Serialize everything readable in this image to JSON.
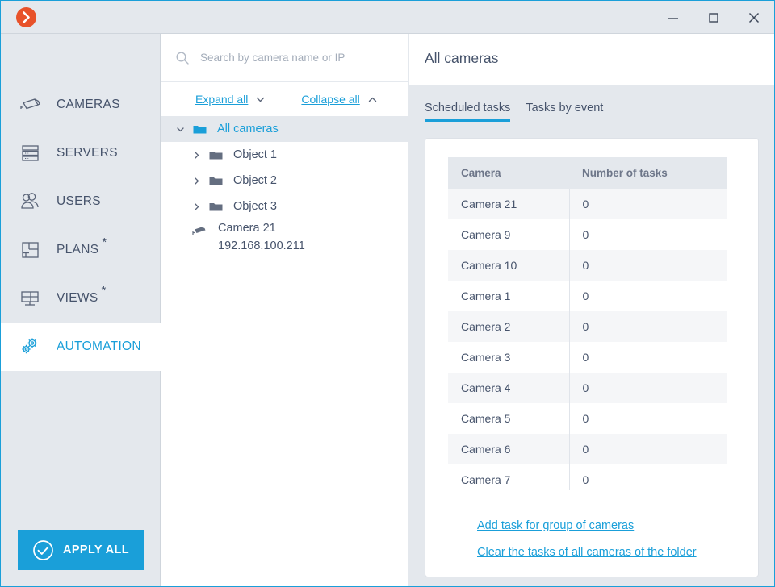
{
  "window": {
    "logo_icon": "chevron-right-circle-icon",
    "controls": [
      {
        "name": "minimize",
        "icon": "minimize-icon"
      },
      {
        "name": "maximize",
        "icon": "maximize-icon"
      },
      {
        "name": "close",
        "icon": "close-icon"
      }
    ]
  },
  "colors": {
    "accent": "#1a9fd9",
    "logo": "#e8522a",
    "text": "#46536b",
    "panel": "#e4e8ed"
  },
  "sidebar": {
    "items": [
      {
        "label": "CAMERAS",
        "icon": "camera-icon",
        "star": "",
        "active": false
      },
      {
        "label": "SERVERS",
        "icon": "server-icon",
        "star": "",
        "active": false
      },
      {
        "label": "USERS",
        "icon": "users-icon",
        "star": "",
        "active": false
      },
      {
        "label": "PLANS",
        "icon": "plans-icon",
        "star": "*",
        "active": false
      },
      {
        "label": "VIEWS",
        "icon": "views-icon",
        "star": "*",
        "active": false
      },
      {
        "label": "AUTOMATION",
        "icon": "gears-icon",
        "star": "",
        "active": true
      }
    ],
    "apply_all": {
      "label": "APPLY ALL",
      "icon": "check-circle-icon"
    }
  },
  "tree_panel": {
    "search": {
      "placeholder": "Search by camera name or IP",
      "value": "",
      "icon": "search-icon"
    },
    "expand_all": {
      "label": "Expand all",
      "icon": "chevron-down-icon"
    },
    "collapse_all": {
      "label": "Collapse all",
      "icon": "chevron-up-icon"
    },
    "nodes": [
      {
        "label": "All cameras",
        "icon": "folder-open-icon",
        "arrow": "chevron-down-icon",
        "selected": true,
        "depth": 0
      },
      {
        "label": "Object 1",
        "icon": "folder-icon",
        "arrow": "chevron-right-icon",
        "selected": false,
        "depth": 1
      },
      {
        "label": "Object 2",
        "icon": "folder-icon",
        "arrow": "chevron-right-icon",
        "selected": false,
        "depth": 1
      },
      {
        "label": "Object 3",
        "icon": "folder-icon",
        "arrow": "chevron-right-icon",
        "selected": false,
        "depth": 1
      }
    ],
    "camera_node": {
      "name": "Camera 21",
      "ip": "192.168.100.211",
      "icon": "camera-icon"
    }
  },
  "content": {
    "title": "All cameras",
    "tabs": [
      {
        "label": "Scheduled tasks",
        "active": true
      },
      {
        "label": "Tasks by event",
        "active": false
      }
    ],
    "table": {
      "headers": [
        "Camera",
        "Number of tasks"
      ],
      "rows": [
        [
          "Camera 21",
          "0"
        ],
        [
          "Camera 9",
          "0"
        ],
        [
          "Camera 10",
          "0"
        ],
        [
          "Camera 1",
          "0"
        ],
        [
          "Camera 2",
          "0"
        ],
        [
          "Camera 3",
          "0"
        ],
        [
          "Camera 4",
          "0"
        ],
        [
          "Camera 5",
          "0"
        ],
        [
          "Camera 6",
          "0"
        ],
        [
          "Camera 7",
          "0"
        ],
        [
          "",
          ""
        ]
      ]
    },
    "links": [
      "Add task for group of cameras",
      "Clear the tasks of all cameras of the folder"
    ]
  }
}
